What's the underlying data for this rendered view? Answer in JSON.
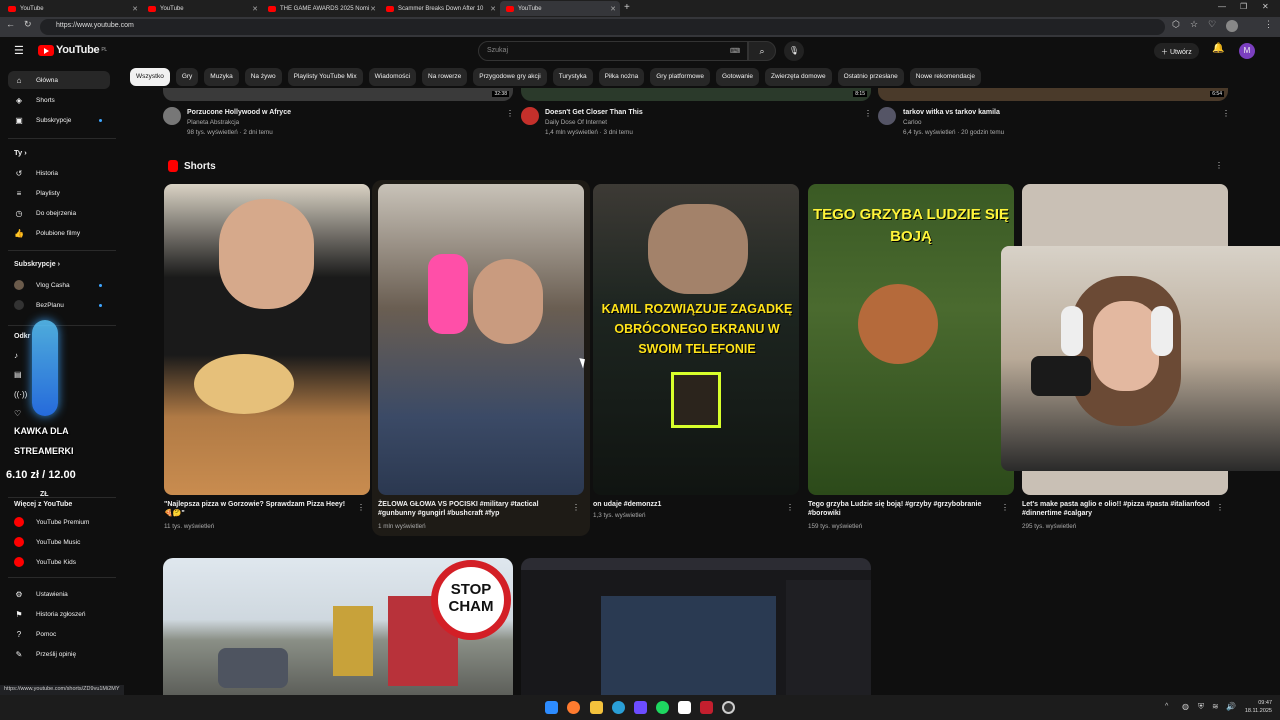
{
  "browser": {
    "tabs": [
      {
        "label": "YouTube",
        "active": false
      },
      {
        "label": "YouTube",
        "active": false
      },
      {
        "label": "THE GAME AWARDS 2025 Nomi",
        "active": false
      },
      {
        "label": "Scammer Breaks Down After 10",
        "active": false
      },
      {
        "label": "YouTube",
        "active": true
      }
    ],
    "new_tab": "+",
    "url": "https://www.youtube.com",
    "status_url": "https://www.youtube.com/shorts/ZD9vu1Mi2MY"
  },
  "header": {
    "logo_text": "YouTube",
    "logo_region": "PL",
    "search_placeholder": "Szukaj",
    "create_label": "Utwórz",
    "avatar_letter": "M"
  },
  "chips": [
    "Wszystko",
    "Gry",
    "Muzyka",
    "Na żywo",
    "Playlisty YouTube Mix",
    "Wiadomości",
    "Na rowerze",
    "Przygodowe gry akcji",
    "Turystyka",
    "Piłka nożna",
    "Gry platformowe",
    "Gotowanie",
    "Zwierzęta domowe",
    "Ostatnio przesłane",
    "Nowe rekomendacje"
  ],
  "sidebar": {
    "main": [
      {
        "label": "Główna",
        "icon": "home-icon"
      },
      {
        "label": "Shorts",
        "icon": "shorts-icon"
      },
      {
        "label": "Subskrypcje",
        "icon": "subscriptions-icon"
      }
    ],
    "you_header": "Ty",
    "you": [
      {
        "label": "Historia",
        "icon": "history-icon"
      },
      {
        "label": "Playlisty",
        "icon": "playlist-icon"
      },
      {
        "label": "Do obejrzenia",
        "icon": "watch-later-icon"
      },
      {
        "label": "Polubione filmy",
        "icon": "like-icon"
      }
    ],
    "subs_header": "Subskrypcje",
    "subs": [
      {
        "label": "Vlog Casha"
      },
      {
        "label": "BezPlanu"
      }
    ],
    "explore_header": "Odkr",
    "more_header": "Więcej z YouTube",
    "more": [
      {
        "label": "YouTube Premium"
      },
      {
        "label": "YouTube Music"
      },
      {
        "label": "YouTube Kids"
      }
    ],
    "settings": [
      {
        "label": "Ustawienia",
        "icon": "settings-icon"
      },
      {
        "label": "Historia zgłoszeń",
        "icon": "flag-icon"
      },
      {
        "label": "Pomoc",
        "icon": "help-icon"
      },
      {
        "label": "Prześlij opinię",
        "icon": "feedback-icon"
      }
    ]
  },
  "overlay": {
    "line1": "KAWKA DLA",
    "line2": "STREAMERKI",
    "price": "6.10 zł / 12.00",
    "currency": "ZŁ"
  },
  "top_videos": [
    {
      "title": "Porzucone Hollywood w Afryce",
      "channel": "Planeta Abstrakcja",
      "meta": "98 tys. wyświetleń · 2 dni temu",
      "duration": "32:38"
    },
    {
      "title": "Doesn't Get Closer Than This",
      "channel": "Daily Dose Of Internet",
      "meta": "1,4 mln wyświetleń · 3 dni temu",
      "duration": "8:15"
    },
    {
      "title": "tarkov witka vs tarkov kamila",
      "channel": "Carloo",
      "meta": "6,4 tys. wyświetleń · 20 godzin temu",
      "duration": "6:54"
    }
  ],
  "shorts_header": "Shorts",
  "shorts": [
    {
      "title": "\"Najlepsza pizza w Gorzowie? Sprawdzam Pizza Heey! 🍕🤔\"",
      "views": "11 tys. wyświetleń",
      "overlay": ""
    },
    {
      "title": "ŻELOWA GŁOWA VS POCISKI #military #tactical #gunbunny #gungirl #bushcraft #fyp",
      "views": "1 mln wyświetleń",
      "overlay": ""
    },
    {
      "title": "on udaje #demonzz1",
      "views": "1,3 tys. wyświetleń",
      "overlay": "KAMIL ROZWIĄZUJE ZAGADKĘ OBRÓCONEGO EKRANU W SWOIM TELEFONIE"
    },
    {
      "title": "Tego grzyba Ludzie się boją! #grzyby #grzybobranie #borowiki",
      "views": "159 tys. wyświetleń",
      "overlay": "TEGO GRZYBA LUDZIE SIĘ BOJĄ"
    },
    {
      "title": "Let's make pasta aglio e olio!! #pizza #pasta #italianfood #dinnertime #calgary",
      "views": "295 tys. wyświetleń",
      "overlay": ""
    }
  ],
  "bottom_videos": [
    {
      "thumb_text": "STOP CHAM"
    }
  ],
  "taskbar": {
    "time": "09:47",
    "date": "18.11.2025"
  }
}
